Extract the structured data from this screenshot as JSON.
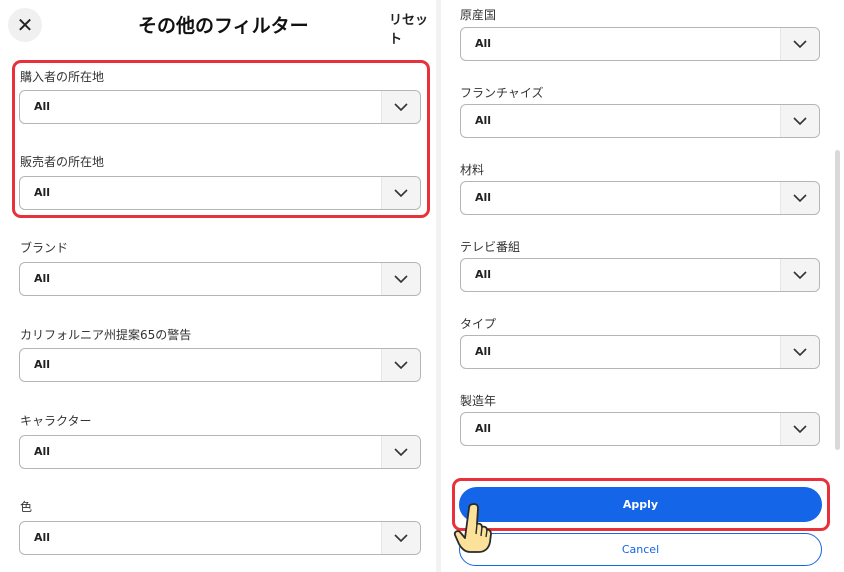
{
  "header": {
    "close_glyph": "✕",
    "title": "その他のフィルター",
    "reset_label": "リセット"
  },
  "left_filters": [
    {
      "label": "購入者の所在地",
      "value": "All"
    },
    {
      "label": "販売者の所在地",
      "value": "All"
    },
    {
      "label": "ブランド",
      "value": "All"
    },
    {
      "label": "カリフォルニア州提案65の警告",
      "value": "All"
    },
    {
      "label": "キャラクター",
      "value": "All"
    },
    {
      "label": "色",
      "value": "All"
    }
  ],
  "right_filters": [
    {
      "label": "原産国",
      "value": "All"
    },
    {
      "label": "フランチャイズ",
      "value": "All"
    },
    {
      "label": "材料",
      "value": "All"
    },
    {
      "label": "テレビ番組",
      "value": "All"
    },
    {
      "label": "タイプ",
      "value": "All"
    },
    {
      "label": "製造年",
      "value": "All"
    }
  ],
  "actions": {
    "apply_label": "Apply",
    "cancel_label": "Cancel"
  },
  "colors": {
    "accent": "#1565e8",
    "highlight": "#e8313a"
  },
  "icons": {
    "close": "close-icon",
    "dropdown": "chevron-down-icon",
    "cursor": "hand-pointer-icon"
  }
}
